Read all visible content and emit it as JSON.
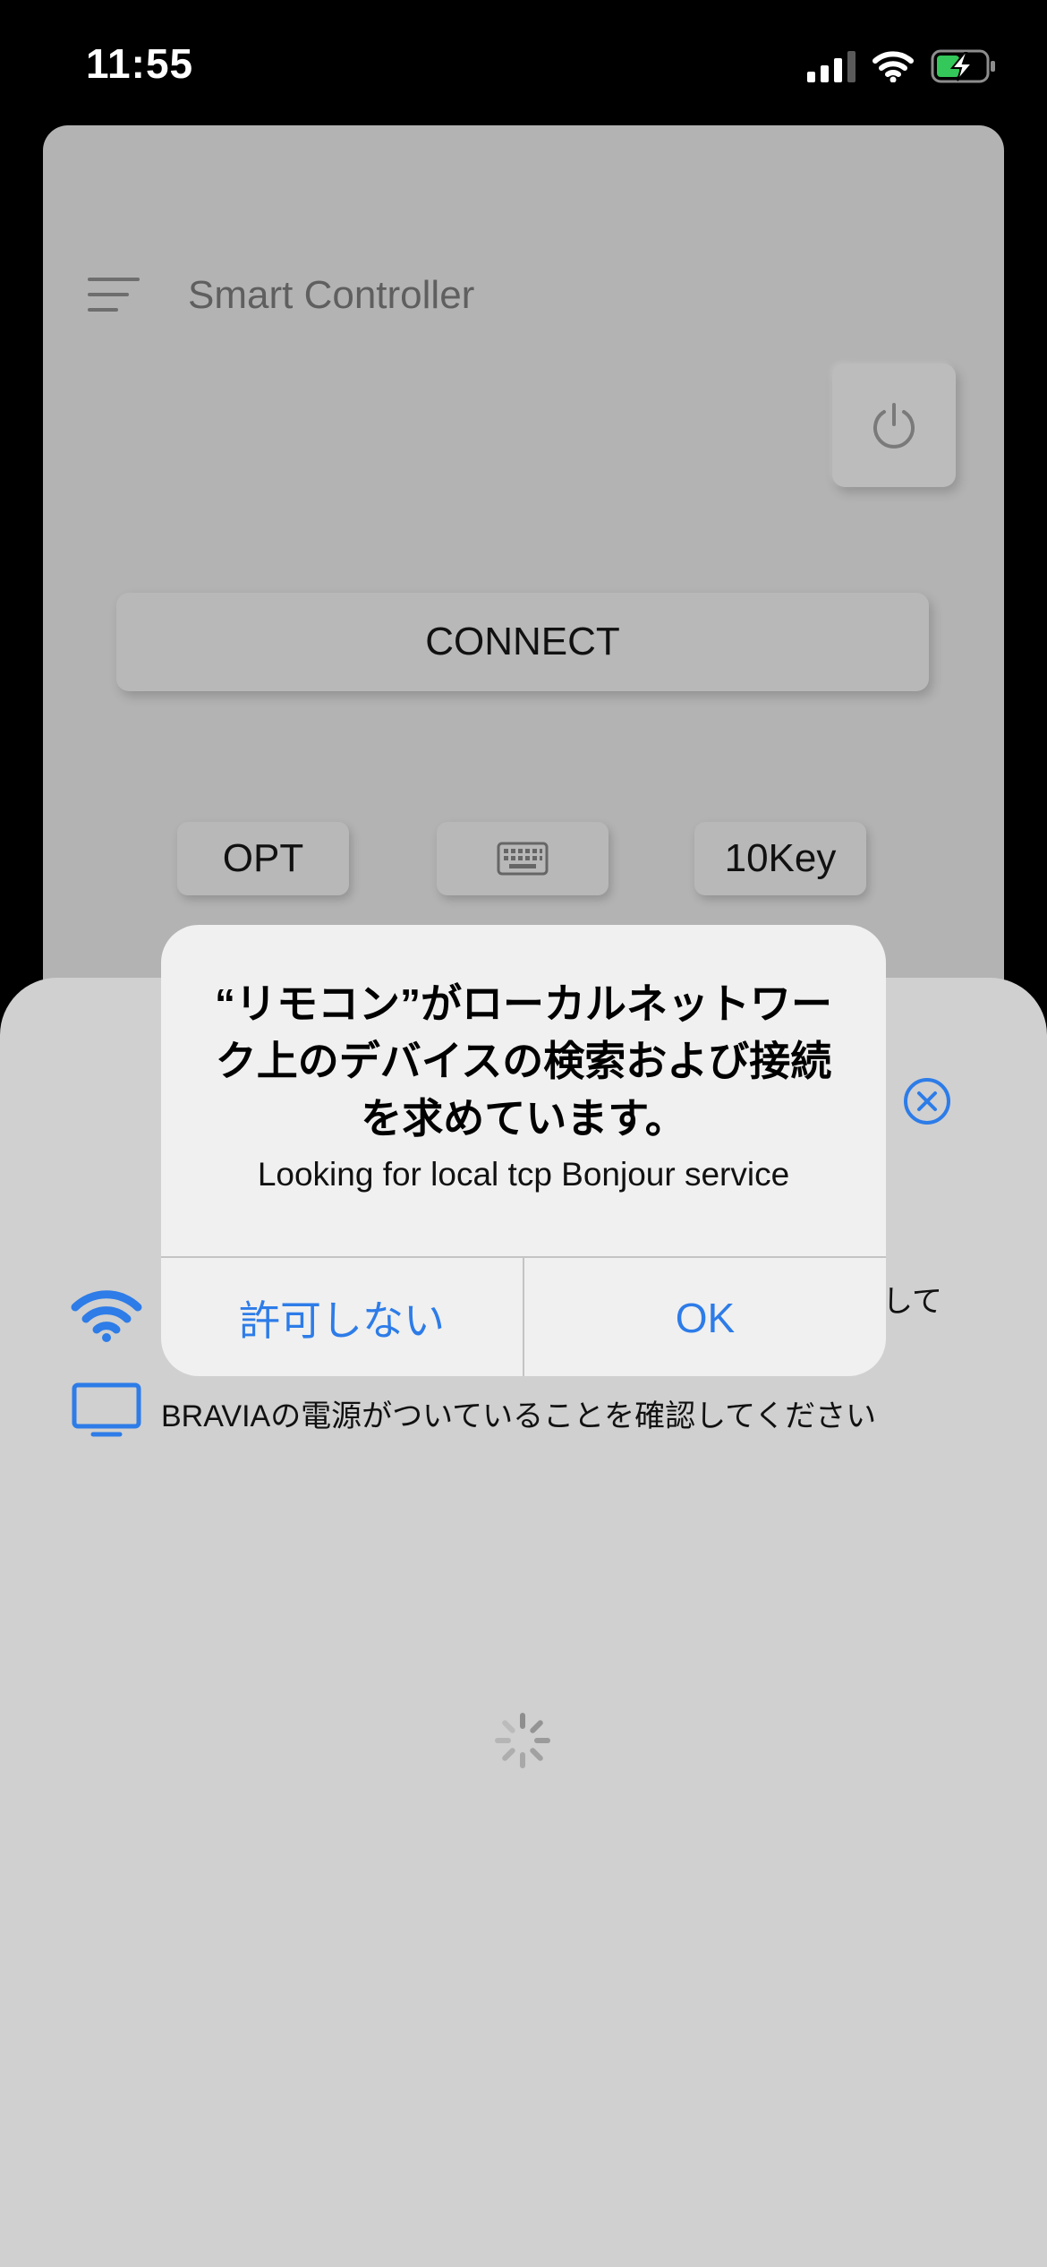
{
  "status_bar": {
    "time": "11:55"
  },
  "app": {
    "title": "Smart Controller",
    "connect_label": "CONNECT",
    "buttons": {
      "opt": "OPT",
      "tenkey": "10Key"
    }
  },
  "sheet": {
    "wifi_text_fragment": "して",
    "tv_text": "BRAVIAの電源がついていることを確認してください"
  },
  "dialog": {
    "title": "“リモコン”がローカルネットワーク上のデバイスの検索および接続を求めています。",
    "message": "Looking for local tcp Bonjour service",
    "deny_label": "許可しない",
    "ok_label": "OK"
  },
  "colors": {
    "accent": "#2d7ce8",
    "dim_overlay": "#b3b3b3",
    "sheet": "#d0d0d0",
    "dialog": "#f0f0f0"
  },
  "icons": [
    "cellular-signal-icon",
    "wifi-icon",
    "battery-charging-icon",
    "menu-icon",
    "power-icon",
    "keyboard-icon",
    "close-icon",
    "tv-icon",
    "loading-spinner-icon"
  ]
}
